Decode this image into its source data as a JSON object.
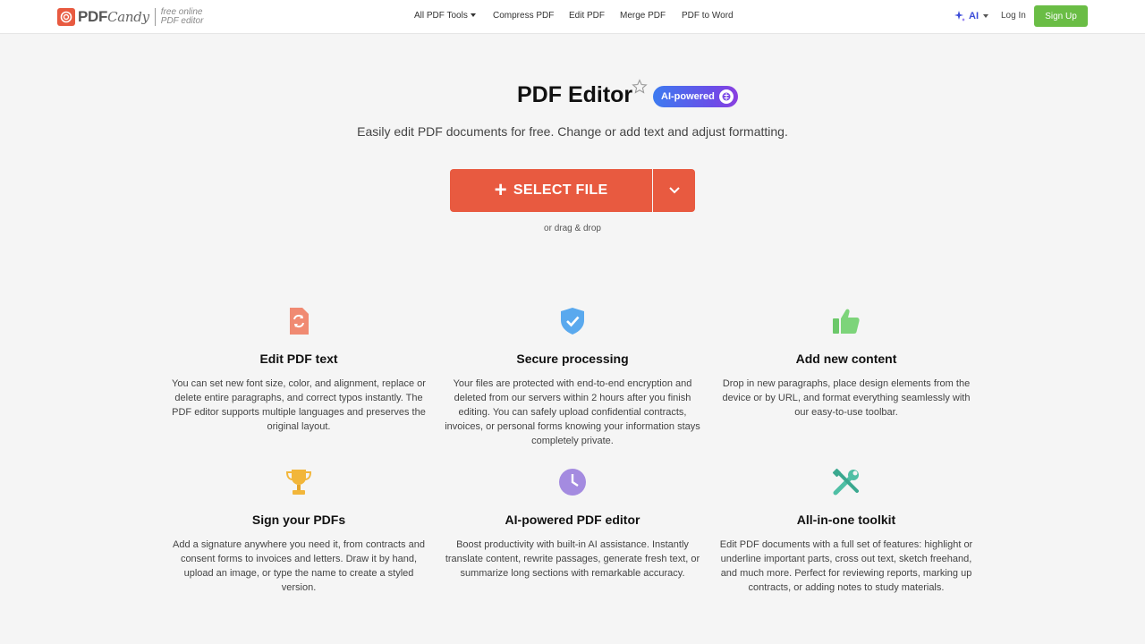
{
  "header": {
    "logo_brand": "PDF",
    "logo_candy": "Candy",
    "logo_tag_line1": "free online",
    "logo_tag_line2": "PDF editor",
    "nav": [
      "All PDF Tools",
      "Compress PDF",
      "Edit PDF",
      "Merge PDF",
      "PDF to Word"
    ],
    "ai_label": "AI",
    "login_label": "Log In",
    "signup_label": "Sign Up"
  },
  "hero": {
    "title": "PDF Editor",
    "badge": "AI-powered",
    "subtitle": "Easily edit PDF documents for free. Change or add text and adjust formatting.",
    "select_label": "SELECT FILE",
    "drag_hint": "or drag & drop"
  },
  "features": [
    {
      "icon": "edit-document-icon",
      "title": "Edit PDF text",
      "text": "You can set new font size, color, and alignment, replace or delete entire paragraphs, and correct typos instantly. The PDF editor supports multiple languages and preserves the original layout."
    },
    {
      "icon": "shield-check-icon",
      "title": "Secure processing",
      "text": "Your files are protected with end-to-end encryption and deleted from our servers within 2 hours after you finish editing. You can safely upload confidential contracts, invoices, or personal forms knowing your information stays completely private."
    },
    {
      "icon": "thumbs-up-icon",
      "title": "Add new content",
      "text": "Drop in new paragraphs, place design elements from the device or by URL, and format everything seamlessly with our easy-to-use toolbar."
    },
    {
      "icon": "trophy-icon",
      "title": "Sign your PDFs",
      "text": "Add a signature anywhere you need it, from contracts and consent forms to invoices and letters. Draw it by hand, upload an image, or type the name to create a styled version."
    },
    {
      "icon": "clock-icon",
      "title": "AI-powered PDF editor",
      "text": "Boost productivity with built-in AI assistance. Instantly translate content, rewrite passages, generate fresh text, or summarize long sections with remarkable accuracy."
    },
    {
      "icon": "tools-icon",
      "title": "All-in-one toolkit",
      "text": "Edit PDF documents with a full set of features: highlight or underline important parts, cross out text, sketch freehand, and much more. Perfect for reviewing reports, marking up contracts, or adding notes to study materials."
    }
  ],
  "colors": {
    "brand": "#e85a40",
    "signup": "#6abd45",
    "ai_accent": "#3b4cd8"
  }
}
